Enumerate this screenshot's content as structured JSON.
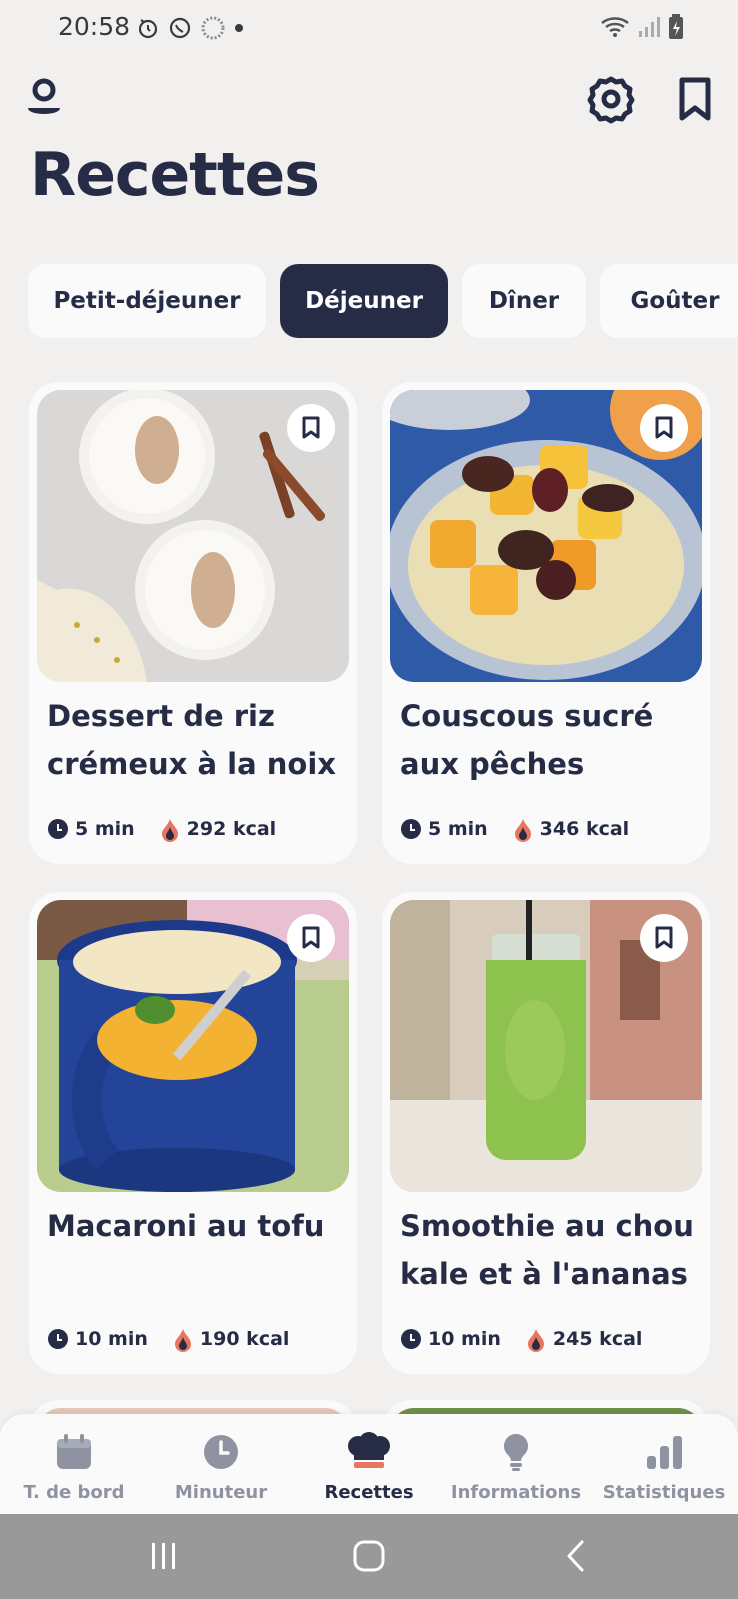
{
  "status_bar": {
    "time": "20:58"
  },
  "page_title": "Recettes",
  "tabs": [
    {
      "label": "Petit-déjeuner",
      "active": false
    },
    {
      "label": "Déjeuner",
      "active": true
    },
    {
      "label": "Dîner",
      "active": false
    },
    {
      "label": "Goûter",
      "active": false
    }
  ],
  "recipes": [
    {
      "title": "Dessert de riz crémeux à la noix ...",
      "time": "5 min",
      "kcal": "292 kcal"
    },
    {
      "title": "Couscous sucré aux pêches",
      "time": "5 min",
      "kcal": "346 kcal"
    },
    {
      "title": "Macaroni au tofu",
      "time": "10 min",
      "kcal": "190 kcal"
    },
    {
      "title": "Smoothie au chou kale et à l'ananas",
      "time": "10 min",
      "kcal": "245 kcal"
    }
  ],
  "bottom_nav": [
    {
      "label": "T. de bord",
      "icon": "calendar-icon",
      "active": false
    },
    {
      "label": "Minuteur",
      "icon": "clock-icon",
      "active": false
    },
    {
      "label": "Recettes",
      "icon": "chef-hat-icon",
      "active": true
    },
    {
      "label": "Informations",
      "icon": "lightbulb-icon",
      "active": false
    },
    {
      "label": "Statistiques",
      "icon": "bar-chart-icon",
      "active": false
    }
  ],
  "colors": {
    "primary": "#262c45",
    "background": "#f2f0ef",
    "card": "#fbfafa",
    "accent": "#e8755f",
    "inactive": "#8f93a1"
  }
}
